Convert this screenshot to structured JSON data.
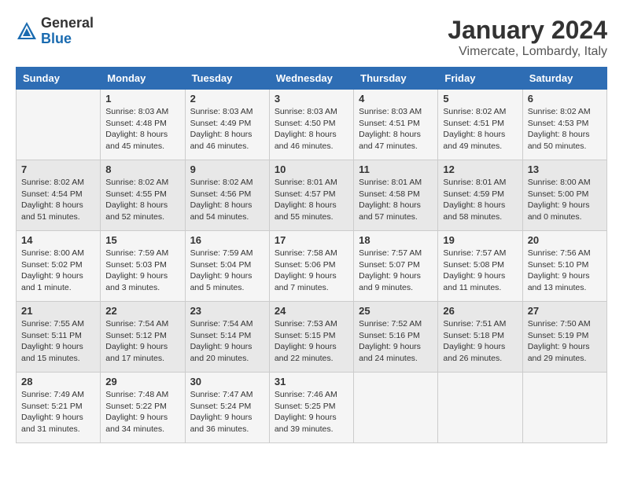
{
  "logo": {
    "general": "General",
    "blue": "Blue"
  },
  "title": {
    "month": "January 2024",
    "location": "Vimercate, Lombardy, Italy"
  },
  "headers": [
    "Sunday",
    "Monday",
    "Tuesday",
    "Wednesday",
    "Thursday",
    "Friday",
    "Saturday"
  ],
  "weeks": [
    [
      {
        "day": "",
        "info": ""
      },
      {
        "day": "1",
        "info": "Sunrise: 8:03 AM\nSunset: 4:48 PM\nDaylight: 8 hours\nand 45 minutes."
      },
      {
        "day": "2",
        "info": "Sunrise: 8:03 AM\nSunset: 4:49 PM\nDaylight: 8 hours\nand 46 minutes."
      },
      {
        "day": "3",
        "info": "Sunrise: 8:03 AM\nSunset: 4:50 PM\nDaylight: 8 hours\nand 46 minutes."
      },
      {
        "day": "4",
        "info": "Sunrise: 8:03 AM\nSunset: 4:51 PM\nDaylight: 8 hours\nand 47 minutes."
      },
      {
        "day": "5",
        "info": "Sunrise: 8:02 AM\nSunset: 4:51 PM\nDaylight: 8 hours\nand 49 minutes."
      },
      {
        "day": "6",
        "info": "Sunrise: 8:02 AM\nSunset: 4:53 PM\nDaylight: 8 hours\nand 50 minutes."
      }
    ],
    [
      {
        "day": "7",
        "info": "Sunrise: 8:02 AM\nSunset: 4:54 PM\nDaylight: 8 hours\nand 51 minutes."
      },
      {
        "day": "8",
        "info": "Sunrise: 8:02 AM\nSunset: 4:55 PM\nDaylight: 8 hours\nand 52 minutes."
      },
      {
        "day": "9",
        "info": "Sunrise: 8:02 AM\nSunset: 4:56 PM\nDaylight: 8 hours\nand 54 minutes."
      },
      {
        "day": "10",
        "info": "Sunrise: 8:01 AM\nSunset: 4:57 PM\nDaylight: 8 hours\nand 55 minutes."
      },
      {
        "day": "11",
        "info": "Sunrise: 8:01 AM\nSunset: 4:58 PM\nDaylight: 8 hours\nand 57 minutes."
      },
      {
        "day": "12",
        "info": "Sunrise: 8:01 AM\nSunset: 4:59 PM\nDaylight: 8 hours\nand 58 minutes."
      },
      {
        "day": "13",
        "info": "Sunrise: 8:00 AM\nSunset: 5:00 PM\nDaylight: 9 hours\nand 0 minutes."
      }
    ],
    [
      {
        "day": "14",
        "info": "Sunrise: 8:00 AM\nSunset: 5:02 PM\nDaylight: 9 hours\nand 1 minute."
      },
      {
        "day": "15",
        "info": "Sunrise: 7:59 AM\nSunset: 5:03 PM\nDaylight: 9 hours\nand 3 minutes."
      },
      {
        "day": "16",
        "info": "Sunrise: 7:59 AM\nSunset: 5:04 PM\nDaylight: 9 hours\nand 5 minutes."
      },
      {
        "day": "17",
        "info": "Sunrise: 7:58 AM\nSunset: 5:06 PM\nDaylight: 9 hours\nand 7 minutes."
      },
      {
        "day": "18",
        "info": "Sunrise: 7:57 AM\nSunset: 5:07 PM\nDaylight: 9 hours\nand 9 minutes."
      },
      {
        "day": "19",
        "info": "Sunrise: 7:57 AM\nSunset: 5:08 PM\nDaylight: 9 hours\nand 11 minutes."
      },
      {
        "day": "20",
        "info": "Sunrise: 7:56 AM\nSunset: 5:10 PM\nDaylight: 9 hours\nand 13 minutes."
      }
    ],
    [
      {
        "day": "21",
        "info": "Sunrise: 7:55 AM\nSunset: 5:11 PM\nDaylight: 9 hours\nand 15 minutes."
      },
      {
        "day": "22",
        "info": "Sunrise: 7:54 AM\nSunset: 5:12 PM\nDaylight: 9 hours\nand 17 minutes."
      },
      {
        "day": "23",
        "info": "Sunrise: 7:54 AM\nSunset: 5:14 PM\nDaylight: 9 hours\nand 20 minutes."
      },
      {
        "day": "24",
        "info": "Sunrise: 7:53 AM\nSunset: 5:15 PM\nDaylight: 9 hours\nand 22 minutes."
      },
      {
        "day": "25",
        "info": "Sunrise: 7:52 AM\nSunset: 5:16 PM\nDaylight: 9 hours\nand 24 minutes."
      },
      {
        "day": "26",
        "info": "Sunrise: 7:51 AM\nSunset: 5:18 PM\nDaylight: 9 hours\nand 26 minutes."
      },
      {
        "day": "27",
        "info": "Sunrise: 7:50 AM\nSunset: 5:19 PM\nDaylight: 9 hours\nand 29 minutes."
      }
    ],
    [
      {
        "day": "28",
        "info": "Sunrise: 7:49 AM\nSunset: 5:21 PM\nDaylight: 9 hours\nand 31 minutes."
      },
      {
        "day": "29",
        "info": "Sunrise: 7:48 AM\nSunset: 5:22 PM\nDaylight: 9 hours\nand 34 minutes."
      },
      {
        "day": "30",
        "info": "Sunrise: 7:47 AM\nSunset: 5:24 PM\nDaylight: 9 hours\nand 36 minutes."
      },
      {
        "day": "31",
        "info": "Sunrise: 7:46 AM\nSunset: 5:25 PM\nDaylight: 9 hours\nand 39 minutes."
      },
      {
        "day": "",
        "info": ""
      },
      {
        "day": "",
        "info": ""
      },
      {
        "day": "",
        "info": ""
      }
    ]
  ]
}
